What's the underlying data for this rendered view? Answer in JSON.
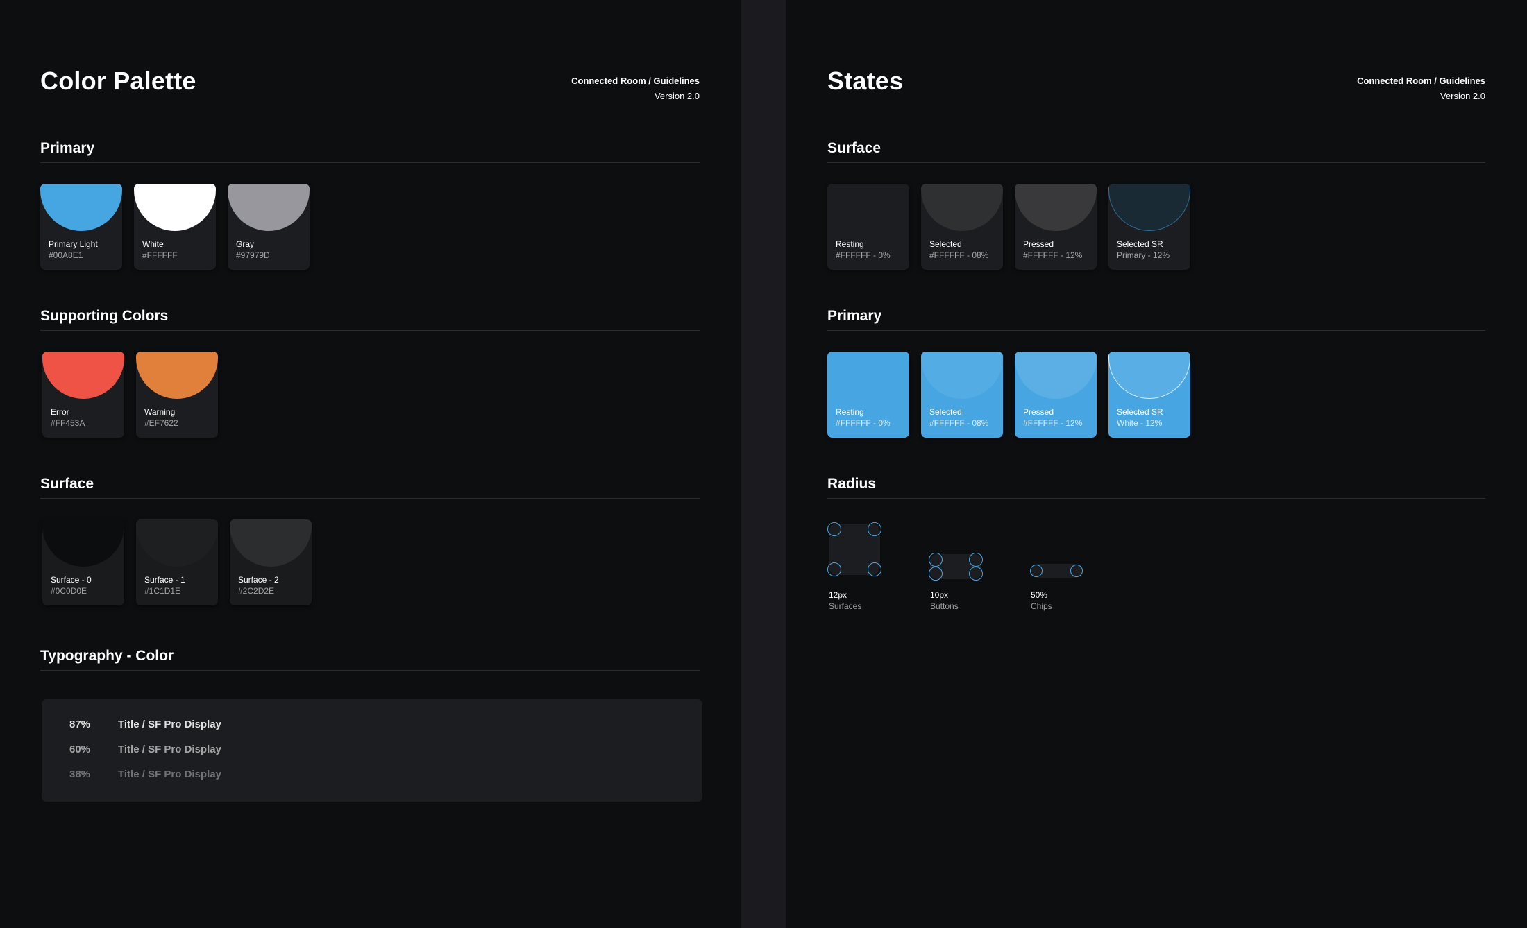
{
  "left_board": {
    "title": "Color Palette",
    "meta_path": "Connected Room  / Guidelines",
    "meta_version": "Version 2.0",
    "primary": {
      "title": "Primary",
      "swatches": [
        {
          "name": "Primary Light",
          "code": "#00A8E1",
          "color": "#45a6e1"
        },
        {
          "name": "White",
          "code": "#FFFFFF",
          "color": "#ffffff"
        },
        {
          "name": "Gray",
          "code": "#97979D",
          "color": "#97979d"
        }
      ]
    },
    "supporting": {
      "title": "Supporting Colors",
      "swatches": [
        {
          "name": "Error",
          "code": "#FF453A",
          "color": "#ef5345"
        },
        {
          "name": "Warning",
          "code": "#EF7622",
          "color": "#e0803a"
        }
      ]
    },
    "surface": {
      "title": "Surface",
      "swatches": [
        {
          "name": "Surface - 0",
          "code": "#0C0D0E",
          "color": "#0c0d0e"
        },
        {
          "name": "Surface - 1",
          "code": "#1C1D1E",
          "color": "#1c1d1e"
        },
        {
          "name": "Surface - 2",
          "code": "#2C2D2E",
          "color": "#2c2d2e"
        }
      ]
    },
    "typography": {
      "title": "Typography - Color",
      "rows": [
        {
          "pct": "87%",
          "label": "Title / SF Pro Display",
          "opacity": 0.87
        },
        {
          "pct": "60%",
          "label": "Title / SF Pro Display",
          "opacity": 0.6
        },
        {
          "pct": "38%",
          "label": "Title / SF Pro Display",
          "opacity": 0.38
        }
      ]
    }
  },
  "right_board": {
    "title": "States",
    "meta_path": "Connected Room  / Guidelines",
    "meta_version": "Version 2.0",
    "surface": {
      "title": "Surface",
      "swatches": [
        {
          "name": "Resting",
          "code": "#FFFFFF - 0%"
        },
        {
          "name": "Selected",
          "code": "#FFFFFF - 08%"
        },
        {
          "name": "Pressed",
          "code": "#FFFFFF - 12%"
        },
        {
          "name": "Selected SR",
          "code": "Primary - 12%"
        }
      ]
    },
    "primary": {
      "title": "Primary",
      "swatches": [
        {
          "name": "Resting",
          "code": "#FFFFFF - 0%"
        },
        {
          "name": "Selected",
          "code": "#FFFFFF - 08%"
        },
        {
          "name": "Pressed",
          "code": "#FFFFFF - 12%"
        },
        {
          "name": "Selected SR",
          "code": "White - 12%"
        }
      ]
    },
    "radius": {
      "title": "Radius",
      "items": [
        {
          "value": "12px",
          "label": "Surfaces"
        },
        {
          "value": "10px",
          "label": "Buttons"
        },
        {
          "value": "50%",
          "label": "Chips"
        }
      ]
    }
  },
  "colors": {
    "background": "#0d0e10",
    "gutter": "#1b1b1f",
    "card": "#1c1d20",
    "accent": "#47a6e2"
  }
}
